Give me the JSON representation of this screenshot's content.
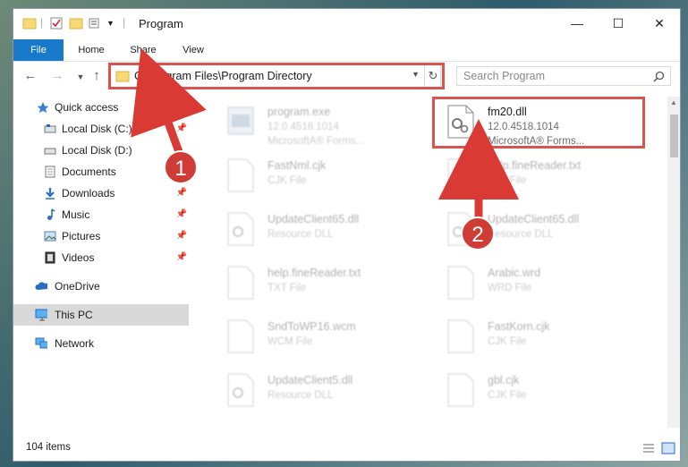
{
  "window": {
    "title": "Program",
    "minimize": "—",
    "maximize": "☐",
    "close": "✕"
  },
  "ribbon": {
    "tabs": [
      "File",
      "Home",
      "Share",
      "View"
    ]
  },
  "address": {
    "path": "C:\\Program Files\\Program Directory",
    "search_placeholder": "Search Program"
  },
  "nav": {
    "quick_access": "Quick access",
    "items": [
      {
        "label": "Local Disk (C:)",
        "icon": "drive-icon",
        "pinned": true
      },
      {
        "label": "Local Disk (D:)",
        "icon": "drive-icon",
        "pinned": false
      },
      {
        "label": "Documents",
        "icon": "documents-icon",
        "pinned": true
      },
      {
        "label": "Downloads",
        "icon": "download-icon",
        "pinned": true
      },
      {
        "label": "Music",
        "icon": "music-icon",
        "pinned": true
      },
      {
        "label": "Pictures",
        "icon": "pictures-icon",
        "pinned": true
      },
      {
        "label": "Videos",
        "icon": "videos-icon",
        "pinned": true
      }
    ],
    "onedrive": "OneDrive",
    "thispc": "This PC",
    "network": "Network",
    "pin_glyph": "📌"
  },
  "files": [
    {
      "name": "program.exe",
      "l1": "12.0.4518.1014",
      "l2": "MicrosoftA® Forms..."
    },
    {
      "name": "fm20.dll",
      "l1": "12.0.4518.1014",
      "l2": "MicrosoftA® Forms..."
    },
    {
      "name": "FastNml.cjk",
      "l1": "CJK File",
      "l2": ""
    },
    {
      "name": "help.fineReader.txt",
      "l1": "TXT File",
      "l2": ""
    },
    {
      "name": "UpdateClient65.dll",
      "l1": "Resource DLL",
      "l2": ""
    },
    {
      "name": "UpdateClient65.dll",
      "l1": "Resource DLL",
      "l2": ""
    },
    {
      "name": "help.fineReader.txt",
      "l1": "TXT File",
      "l2": ""
    },
    {
      "name": "Arabic.wrd",
      "l1": "WRD File",
      "l2": ""
    },
    {
      "name": "SndToWP16.wcm",
      "l1": "WCM File",
      "l2": ""
    },
    {
      "name": "FastKorn.cjk",
      "l1": "CJK File",
      "l2": ""
    },
    {
      "name": "UpdateClient5.dll",
      "l1": "Resource DLL",
      "l2": ""
    },
    {
      "name": "gbl.cjk",
      "l1": "CJK File",
      "l2": ""
    }
  ],
  "status": {
    "count": "104 items"
  },
  "annotations": {
    "step1": "1",
    "step2": "2"
  },
  "colors": {
    "accent": "#1979ca",
    "annotation": "#d9534f"
  }
}
